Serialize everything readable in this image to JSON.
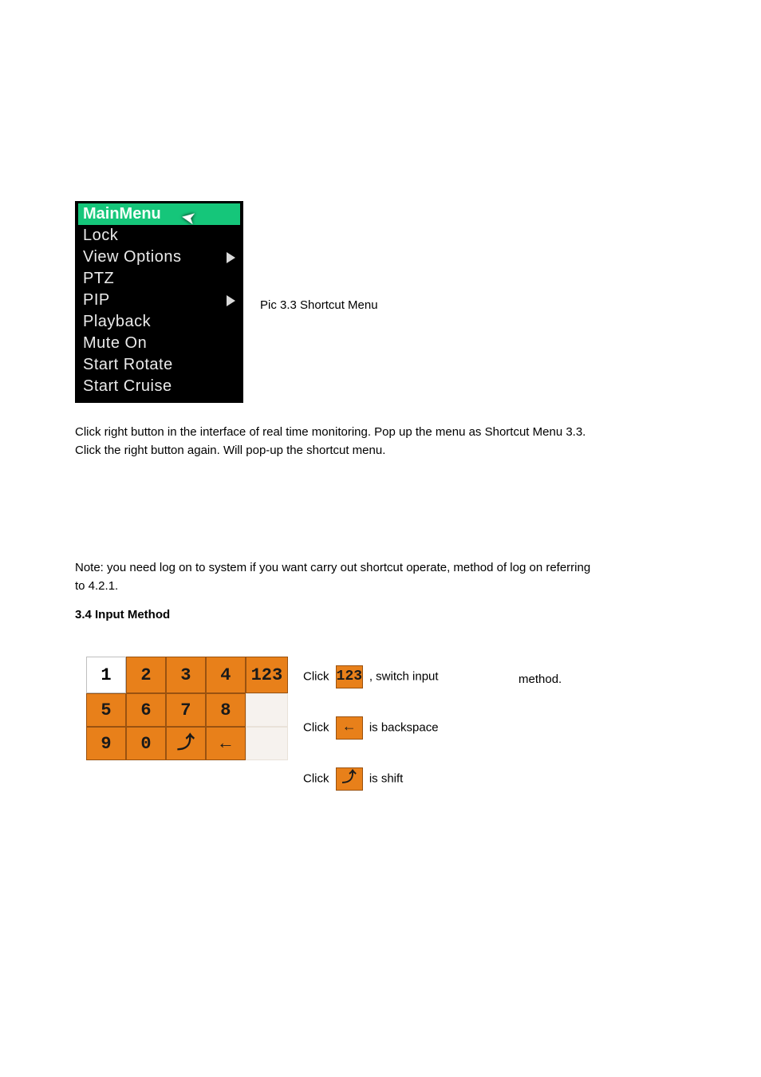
{
  "menu": {
    "items": [
      {
        "label": "MainMenu",
        "selected": true
      },
      {
        "label": "Lock"
      },
      {
        "label": "View Options",
        "submenu": true
      },
      {
        "label": "PTZ"
      },
      {
        "label": "PIP",
        "submenu": true
      },
      {
        "label": "Playback"
      },
      {
        "label": "Mute On"
      },
      {
        "label": "Start Rotate"
      },
      {
        "label": "Start Cruise"
      }
    ],
    "caption": "Pic 3.3 Shortcut Menu"
  },
  "paragraphs": {
    "p1a": "Click right button in the interface of real time monitoring. Pop up the menu as Shortcut Menu 3.3.",
    "p1b": "Click the right button again. Will pop-up the shortcut menu.",
    "p2": "Note: you need log on to system if you want carry out shortcut operate, method of log on referring",
    "p2b": "to 4.2.1.",
    "h": "3.4 Input Method"
  },
  "keypad": {
    "rows": [
      [
        "1",
        "2",
        "3",
        "4",
        "123"
      ],
      [
        "5",
        "6",
        "7",
        "8",
        ""
      ],
      [
        "9",
        "0",
        "shift",
        "back",
        ""
      ]
    ],
    "selected": "1"
  },
  "legend": {
    "click_prefix": "Click ",
    "item1_chip": "123",
    "item1_tail": ", switch input",
    "method_line": "method.",
    "item2_chip": "←",
    "item2_tail": " is backspace",
    "item3_chip": "⤴",
    "item3_tail": " is shift"
  }
}
